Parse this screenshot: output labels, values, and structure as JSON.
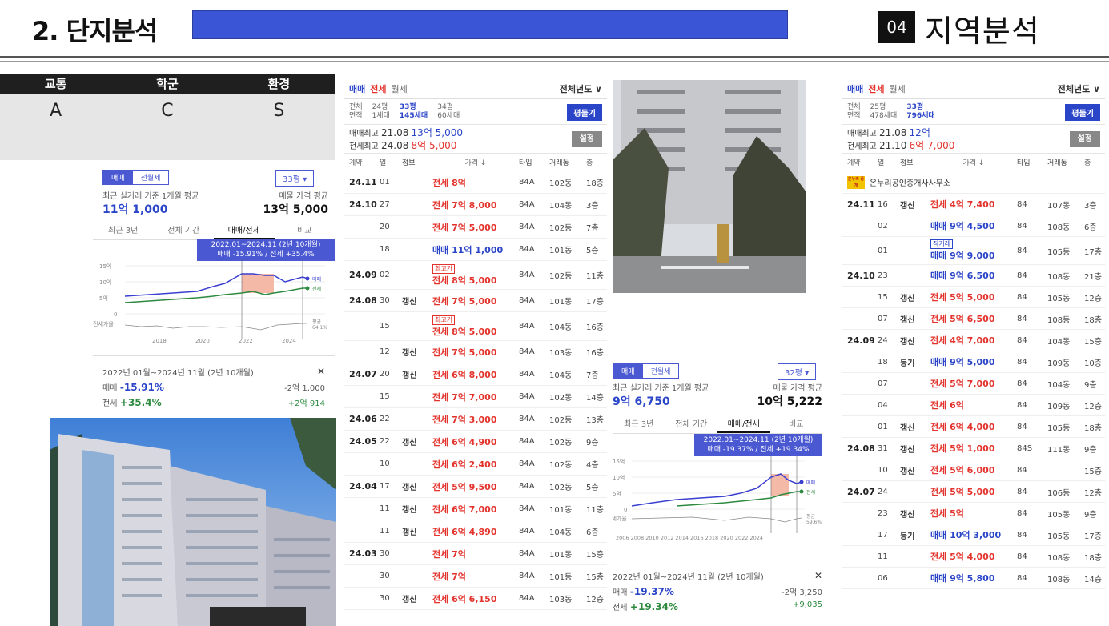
{
  "header": {
    "title": "2. 단지분석",
    "section_number": "04",
    "section_title": "지역분석"
  },
  "grade": {
    "headers": [
      "교통",
      "학군",
      "환경"
    ],
    "values": [
      "A",
      "C",
      "S"
    ]
  },
  "chart1": {
    "seg_on": "매매",
    "seg_off": "전월세",
    "dropdown": "33평 ▾",
    "avg_label": "최근 실거래 기준 1개월 평균",
    "avg_value": "11억 1,000",
    "ask_label": "매물 가격 평균",
    "ask_value": "13억 5,000",
    "tabs": [
      "최근 3년",
      "전체 기간",
      "매매/전세",
      "비교"
    ],
    "tip_line1": "2022.01~2024.11 (2년 10개월)",
    "tip_line2": "매매 -15.91% / 전세 +35.4%",
    "y_labels": [
      "15억",
      "10억",
      "5억",
      "0",
      "전세가율"
    ],
    "x_labels": [
      "2018",
      "2020",
      "2022",
      "2024"
    ],
    "legend_m": "매매",
    "legend_j": "전세",
    "legend_r1": "평균",
    "legend_r2": "64.1%",
    "period": "2022년 01월~2024년 11월 (2년 10개월)",
    "close": "✕",
    "m_label": "매매",
    "m_pct": "-15.91%",
    "m_amt": "-2억 1,000",
    "j_label": "전세",
    "j_pct": "+35.4%",
    "j_amt": "+2억 914"
  },
  "chart2": {
    "seg_on": "매매",
    "seg_off": "전월세",
    "dropdown": "32평 ▾",
    "avg_label": "최근 실거래 기준 1개월 평균",
    "avg_value": "9억 6,750",
    "ask_label": "매물 가격 평균",
    "ask_value": "10억 5,222",
    "tabs": [
      "최근 3년",
      "전체 기간",
      "매매/전세",
      "비교"
    ],
    "tip_line1": "2022.01~2024.11 (2년 10개월)",
    "tip_line2": "매매 -19.37% / 전세 +19.34%",
    "y_labels": [
      "15억",
      "10억",
      "5억",
      "0",
      "전세가율"
    ],
    "x_labels": "2006 2008 2010 2012 2014 2016 2018 2020 2022 2024",
    "legend_m": "매매",
    "legend_j": "전세",
    "legend_r1": "평균",
    "legend_r2": "59.6%",
    "period": "2022년 01월~2024년 11월 (2년 10개월)",
    "close": "✕",
    "m_label": "매매",
    "m_pct": "-19.37%",
    "m_amt": "-2억 3,250",
    "j_label": "전세",
    "j_pct": "+19.34%",
    "j_amt": "+9,035"
  },
  "panel1": {
    "tabs": [
      "매매",
      "전세",
      "월세"
    ],
    "year_filter": "전체년도 ∨",
    "pyeong_label1": "전체",
    "pyeong_label2": "면적",
    "pyeong": [
      {
        "size": "24평",
        "units": "1세대"
      },
      {
        "size": "33평",
        "units": "145세대"
      },
      {
        "size": "34평",
        "units": "60세대"
      }
    ],
    "btn_pyeong": "평둘기",
    "max_m_label": "매매최고",
    "max_m_date": "21.08",
    "max_m_val": "13억 5,000",
    "max_j_label": "전세최고",
    "max_j_date": "24.08",
    "max_j_val": "8억 5,000",
    "btn_set": "설정",
    "columns": [
      "계약",
      "일",
      "정보",
      "가격 ↓",
      "타입",
      "거래동",
      "층"
    ],
    "rows": [
      {
        "ym": "24.11",
        "d": "01",
        "info": "",
        "badge": "",
        "price": "전세 8억",
        "k": "j",
        "type": "84A",
        "dong": "102동",
        "fl": "18층"
      },
      {
        "ym": "24.10",
        "d": "27",
        "info": "",
        "badge": "",
        "price": "전세 7억 8,000",
        "k": "j",
        "type": "84A",
        "dong": "104동",
        "fl": "3층"
      },
      {
        "ym": "",
        "d": "20",
        "info": "",
        "badge": "",
        "price": "전세 7억 5,000",
        "k": "j",
        "type": "84A",
        "dong": "102동",
        "fl": "7층"
      },
      {
        "ym": "",
        "d": "18",
        "info": "",
        "badge": "",
        "price": "매매 11억 1,000",
        "k": "m",
        "type": "84A",
        "dong": "101동",
        "fl": "5층"
      },
      {
        "ym": "24.09",
        "d": "02",
        "info": "",
        "badge": "최고가",
        "price": "전세 8억 5,000",
        "k": "j",
        "type": "84A",
        "dong": "102동",
        "fl": "11층"
      },
      {
        "ym": "24.08",
        "d": "30",
        "info": "갱신",
        "badge": "",
        "price": "전세 7억 5,000",
        "k": "j",
        "type": "84A",
        "dong": "101동",
        "fl": "17층"
      },
      {
        "ym": "",
        "d": "15",
        "info": "",
        "badge": "최고가",
        "price": "전세 8억 5,000",
        "k": "j",
        "type": "84A",
        "dong": "104동",
        "fl": "16층"
      },
      {
        "ym": "",
        "d": "12",
        "info": "갱신",
        "badge": "",
        "price": "전세 7억 5,000",
        "k": "j",
        "type": "84A",
        "dong": "103동",
        "fl": "16층"
      },
      {
        "ym": "24.07",
        "d": "20",
        "info": "갱신",
        "badge": "",
        "price": "전세 6억 8,000",
        "k": "j",
        "type": "84A",
        "dong": "104동",
        "fl": "7층"
      },
      {
        "ym": "",
        "d": "15",
        "info": "",
        "badge": "",
        "price": "전세 7억 7,000",
        "k": "j",
        "type": "84A",
        "dong": "102동",
        "fl": "14층"
      },
      {
        "ym": "24.06",
        "d": "22",
        "info": "",
        "badge": "",
        "price": "전세 7억 3,000",
        "k": "j",
        "type": "84A",
        "dong": "102동",
        "fl": "13층"
      },
      {
        "ym": "24.05",
        "d": "22",
        "info": "갱신",
        "badge": "",
        "price": "전세 6억 4,900",
        "k": "j",
        "type": "84A",
        "dong": "102동",
        "fl": "9층"
      },
      {
        "ym": "",
        "d": "10",
        "info": "",
        "badge": "",
        "price": "전세 6억 2,400",
        "k": "j",
        "type": "84A",
        "dong": "102동",
        "fl": "4층"
      },
      {
        "ym": "24.04",
        "d": "17",
        "info": "갱신",
        "badge": "",
        "price": "전세 5억 9,500",
        "k": "j",
        "type": "84A",
        "dong": "102동",
        "fl": "5층"
      },
      {
        "ym": "",
        "d": "11",
        "info": "갱신",
        "badge": "",
        "price": "전세 6억 7,000",
        "k": "j",
        "type": "84A",
        "dong": "101동",
        "fl": "11층"
      },
      {
        "ym": "",
        "d": "11",
        "info": "갱신",
        "badge": "",
        "price": "전세 6억 4,890",
        "k": "j",
        "type": "84A",
        "dong": "104동",
        "fl": "6층"
      },
      {
        "ym": "24.03",
        "d": "30",
        "info": "",
        "badge": "",
        "price": "전세 7억",
        "k": "j",
        "type": "84A",
        "dong": "101동",
        "fl": "15층"
      },
      {
        "ym": "",
        "d": "30",
        "info": "",
        "badge": "",
        "price": "전세 7억",
        "k": "j",
        "type": "84A",
        "dong": "101동",
        "fl": "15층"
      },
      {
        "ym": "",
        "d": "30",
        "info": "갱신",
        "badge": "",
        "price": "전세 6억 6,150",
        "k": "j",
        "type": "84A",
        "dong": "103동",
        "fl": "12층"
      }
    ]
  },
  "panel2": {
    "tabs": [
      "매매",
      "전세",
      "월세"
    ],
    "year_filter": "전체년도 ∨",
    "pyeong_label1": "전체",
    "pyeong_label2": "면적",
    "pyeong": [
      {
        "size": "25평",
        "units": "478세대"
      },
      {
        "size": "33평",
        "units": "796세대"
      }
    ],
    "btn_pyeong": "평둘기",
    "max_m_label": "매매최고",
    "max_m_date": "21.08",
    "max_m_val": "12억",
    "max_j_label": "전세최고",
    "max_j_date": "21.10",
    "max_j_val": "6억 7,000",
    "btn_set": "설정",
    "columns": [
      "계약",
      "일",
      "정보",
      "가격 ↓",
      "타입",
      "거래동",
      "층"
    ],
    "agent_logo": "온누리 중개",
    "agent": "온누리공인중개사사무소",
    "rows": [
      {
        "ym": "24.11",
        "d": "16",
        "info": "갱신",
        "badge": "",
        "price": "전세 4억 7,400",
        "k": "j",
        "type": "84",
        "dong": "107동",
        "fl": "3층"
      },
      {
        "ym": "",
        "d": "02",
        "info": "",
        "badge": "",
        "price": "매매 9억 4,500",
        "k": "m",
        "type": "84",
        "dong": "108동",
        "fl": "6층"
      },
      {
        "ym": "",
        "d": "01",
        "info": "",
        "badge": "직거래",
        "price": "매매 9억 9,000",
        "k": "m",
        "type": "84",
        "dong": "105동",
        "fl": "17층"
      },
      {
        "ym": "24.10",
        "d": "23",
        "info": "",
        "badge": "",
        "price": "매매 9억 6,500",
        "k": "m",
        "type": "84",
        "dong": "108동",
        "fl": "21층"
      },
      {
        "ym": "",
        "d": "15",
        "info": "갱신",
        "badge": "",
        "price": "전세 5억 5,000",
        "k": "j",
        "type": "84",
        "dong": "105동",
        "fl": "12층"
      },
      {
        "ym": "",
        "d": "07",
        "info": "갱신",
        "badge": "",
        "price": "전세 5억 6,500",
        "k": "j",
        "type": "84",
        "dong": "108동",
        "fl": "18층"
      },
      {
        "ym": "24.09",
        "d": "24",
        "info": "갱신",
        "badge": "",
        "price": "전세 4억 7,000",
        "k": "j",
        "type": "84",
        "dong": "104동",
        "fl": "15층"
      },
      {
        "ym": "",
        "d": "18",
        "info": "등기",
        "badge": "",
        "price": "매매 9억 5,000",
        "k": "m",
        "type": "84",
        "dong": "109동",
        "fl": "10층"
      },
      {
        "ym": "",
        "d": "07",
        "info": "",
        "badge": "",
        "price": "전세 5억 7,000",
        "k": "j",
        "type": "84",
        "dong": "104동",
        "fl": "9층"
      },
      {
        "ym": "",
        "d": "04",
        "info": "",
        "badge": "",
        "price": "전세 6억",
        "k": "j",
        "type": "84",
        "dong": "109동",
        "fl": "12층"
      },
      {
        "ym": "",
        "d": "01",
        "info": "갱신",
        "badge": "",
        "price": "전세 6억 4,000",
        "k": "j",
        "type": "84",
        "dong": "105동",
        "fl": "18층"
      },
      {
        "ym": "24.08",
        "d": "31",
        "info": "갱신",
        "badge": "",
        "price": "전세 5억 1,000",
        "k": "j",
        "type": "84S",
        "dong": "111동",
        "fl": "9층"
      },
      {
        "ym": "",
        "d": "10",
        "info": "갱신",
        "badge": "",
        "price": "전세 5억 6,000",
        "k": "j",
        "type": "84",
        "dong": "",
        "fl": "15층"
      },
      {
        "ym": "24.07",
        "d": "24",
        "info": "",
        "badge": "",
        "price": "전세 5억 5,000",
        "k": "j",
        "type": "84",
        "dong": "106동",
        "fl": "12층"
      },
      {
        "ym": "",
        "d": "23",
        "info": "갱신",
        "badge": "",
        "price": "전세 5억",
        "k": "j",
        "type": "84",
        "dong": "105동",
        "fl": "9층"
      },
      {
        "ym": "",
        "d": "17",
        "info": "등기",
        "badge": "",
        "price": "매매 10억 3,000",
        "k": "m",
        "type": "84",
        "dong": "105동",
        "fl": "17층"
      },
      {
        "ym": "",
        "d": "11",
        "info": "",
        "badge": "",
        "price": "전세 5억 4,000",
        "k": "j",
        "type": "84",
        "dong": "108동",
        "fl": "18층"
      },
      {
        "ym": "",
        "d": "06",
        "info": "",
        "badge": "",
        "price": "매매 9억 5,800",
        "k": "m",
        "type": "84",
        "dong": "108동",
        "fl": "14층"
      }
    ]
  }
}
